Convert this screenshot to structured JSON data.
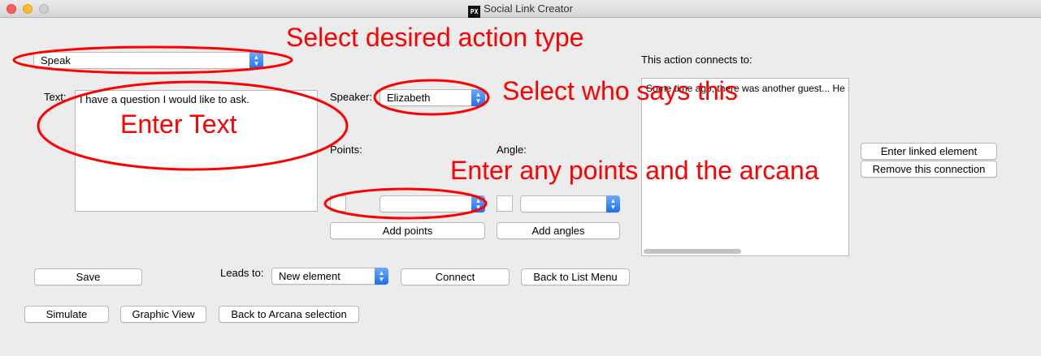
{
  "window": {
    "title": "Social Link Creator",
    "app_icon_text": "PX"
  },
  "action_select": {
    "value": "Speak"
  },
  "text_label": "Text:",
  "text_value": "I have a question I would like to ask.",
  "speaker": {
    "label": "Speaker:",
    "value": "Elizabeth"
  },
  "points": {
    "label": "Points:",
    "add_button": "Add points",
    "value": "",
    "arcana": ""
  },
  "angle": {
    "label": "Angle:",
    "add_button": "Add angles",
    "value": "",
    "selection": ""
  },
  "connects": {
    "label": "This action connects to:",
    "items": [
      "Some time ago, there was another guest... He s"
    ],
    "enter_button": "Enter linked element",
    "remove_button": "Remove this connection"
  },
  "leads_to": {
    "label": "Leads to:",
    "value": "New element",
    "connect_button": "Connect"
  },
  "buttons": {
    "save": "Save",
    "back_list": "Back to List Menu",
    "simulate": "Simulate",
    "graphic_view": "Graphic View",
    "back_arcana": "Back to Arcana selection"
  },
  "annotations": {
    "action_type": "Select desired action type",
    "enter_text": "Enter Text",
    "speaker": "Select who says this",
    "points": "Enter any points and the arcana",
    "color": "#ff0000"
  }
}
